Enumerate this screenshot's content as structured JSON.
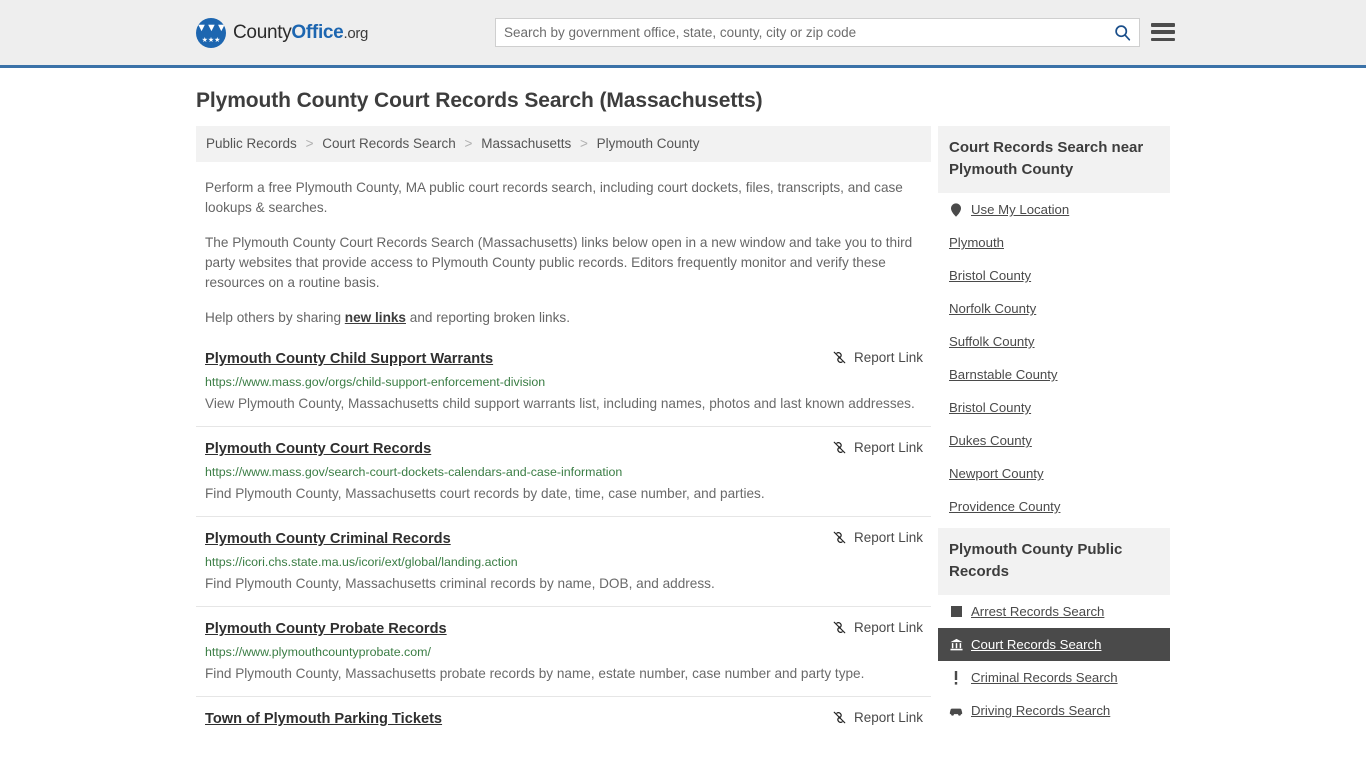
{
  "header": {
    "brand": {
      "part1": "County",
      "part2": "Office",
      "part3": ".org",
      "logo_icon": "eagle-stars-emblem"
    },
    "search": {
      "placeholder": "Search by government office, state, county, city or zip code",
      "value": "",
      "search_icon": "search-icon"
    },
    "menu_icon": "hamburger-menu-icon",
    "accent_color": "#3b72a8"
  },
  "page": {
    "title": "Plymouth County Court Records Search (Massachusetts)"
  },
  "breadcrumb": {
    "separator": ">",
    "items": [
      {
        "label": "Public Records"
      },
      {
        "label": "Court Records Search"
      },
      {
        "label": "Massachusetts"
      },
      {
        "label": "Plymouth County"
      }
    ]
  },
  "intro": {
    "p1": "Perform a free Plymouth County, MA public court records search, including court dockets, files, transcripts, and case lookups & searches.",
    "p2": "The Plymouth County Court Records Search (Massachusetts) links below open in a new window and take you to third party websites that provide access to Plymouth County public records. Editors frequently monitor and verify these resources on a routine basis.",
    "p3_before": "Help others by sharing ",
    "p3_link": "new links",
    "p3_after": " and reporting broken links."
  },
  "results": {
    "report_label": "Report Link",
    "report_icon": "broken-link-icon",
    "items": [
      {
        "title": "Plymouth County Child Support Warrants",
        "url": "https://www.mass.gov/orgs/child-support-enforcement-division",
        "description": "View Plymouth County, Massachusetts child support warrants list, including names, photos and last known addresses."
      },
      {
        "title": "Plymouth County Court Records",
        "url": "https://www.mass.gov/search-court-dockets-calendars-and-case-information",
        "description": "Find Plymouth County, Massachusetts court records by date, time, case number, and parties."
      },
      {
        "title": "Plymouth County Criminal Records",
        "url": "https://icori.chs.state.ma.us/icori/ext/global/landing.action",
        "description": "Find Plymouth County, Massachusetts criminal records by name, DOB, and address."
      },
      {
        "title": "Plymouth County Probate Records",
        "url": "https://www.plymouthcountyprobate.com/",
        "description": "Find Plymouth County, Massachusetts probate records by name, estate number, case number and party type."
      },
      {
        "title": "Town of Plymouth Parking Tickets",
        "url": "",
        "description": ""
      }
    ]
  },
  "sidebar": {
    "nearby": {
      "heading": "Court Records Search near Plymouth County",
      "items": [
        {
          "label": "Use My Location",
          "icon": "location-pin-icon"
        },
        {
          "label": "Plymouth",
          "icon": ""
        },
        {
          "label": "Bristol County",
          "icon": ""
        },
        {
          "label": "Norfolk County",
          "icon": ""
        },
        {
          "label": "Suffolk County",
          "icon": ""
        },
        {
          "label": "Barnstable County",
          "icon": ""
        },
        {
          "label": "Bristol County",
          "icon": ""
        },
        {
          "label": "Dukes County",
          "icon": ""
        },
        {
          "label": "Newport County",
          "icon": ""
        },
        {
          "label": "Providence County",
          "icon": ""
        }
      ]
    },
    "public_records": {
      "heading": "Plymouth County Public Records",
      "items": [
        {
          "label": "Arrest Records Search",
          "icon": "square-badge-icon",
          "active": false
        },
        {
          "label": "Court Records Search",
          "icon": "courthouse-icon",
          "active": true
        },
        {
          "label": "Criminal Records Search",
          "icon": "exclamation-icon",
          "active": false
        },
        {
          "label": "Driving Records Search",
          "icon": "car-icon",
          "active": false
        }
      ]
    },
    "active_color": "#4a4a4a"
  }
}
